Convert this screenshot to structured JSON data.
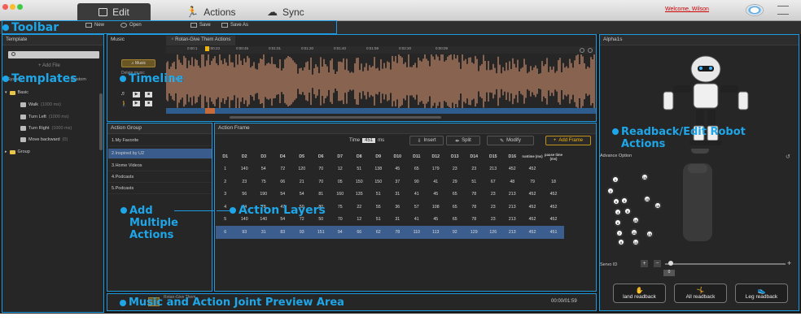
{
  "titlebar": {
    "tabs": [
      "Edit",
      "Actions",
      "Sync"
    ],
    "welcome": "Welcome, Wilson"
  },
  "toolbar": {
    "new": "New",
    "open": "Open",
    "save": "Save",
    "save_as": "Save As"
  },
  "callouts": {
    "toolbar": "Toolbar",
    "templates": "Templates",
    "timeline": "Timeline",
    "add_multiple": [
      "Add",
      "Multiple",
      "Actions"
    ],
    "action_layers": "Action Layers",
    "readback": [
      "Readback/Edit Robot",
      "Actions"
    ],
    "preview": "Music and Action Joint Preview Area"
  },
  "template": {
    "title": "Template",
    "search_placeholder": "",
    "add_file": "Add File",
    "system_label": "System",
    "custom_label": "Custom",
    "folder_basic": "Basic",
    "items": [
      {
        "name": "Walk",
        "time": "(1000 ms)"
      },
      {
        "name": "Turn Left",
        "time": "(1000 ms)"
      },
      {
        "name": "Turn Right",
        "time": "(1000 ms)"
      },
      {
        "name": "Move backward",
        "time": "(0)"
      }
    ],
    "folder_group": "Group"
  },
  "music": {
    "title": "Music",
    "track_tab": "Rotan-Give Them Actions",
    "ticks": [
      "0:00:1",
      "0:00:23",
      "0:00:45",
      "0:01:01",
      "0:01:20",
      "0:01:40",
      "0:01:59",
      "0:02:20",
      "0:00:09"
    ],
    "music_btn": "Music",
    "delete_btn": "Delete music"
  },
  "action_group": {
    "title": "Action Group",
    "items": [
      "1.My Favorite",
      "2.Inspired by U2",
      "3.Home Videos",
      "4.Podcasts",
      "5.Podcasts"
    ],
    "selected": 1
  },
  "action_frame": {
    "title": "Action Frame",
    "time_label": "Time",
    "time_value": "451",
    "time_unit": "ms",
    "insert": "Insert",
    "split": "Split",
    "modify": "Modify",
    "add_frame": "Add Frame",
    "headers": [
      "D1",
      "D2",
      "D3",
      "D4",
      "D5",
      "D6",
      "D7",
      "D8",
      "D9",
      "D10",
      "D11",
      "D12",
      "D13",
      "D14",
      "D15",
      "D16",
      "runtime (ms)",
      "pause time (ms)"
    ],
    "rows": [
      [
        "1",
        "140",
        "54",
        "72",
        "120",
        "70",
        "12",
        "51",
        "138",
        "45",
        "65",
        "179",
        "23",
        "23",
        "213",
        "452",
        "452"
      ],
      [
        "2",
        "23",
        "75",
        "06",
        "21",
        "70",
        "05",
        "150",
        "150",
        "37",
        "90",
        "41",
        "29",
        "51",
        "67",
        "48",
        "79",
        "18"
      ],
      [
        "3",
        "56",
        "190",
        "54",
        "54",
        "81",
        "160",
        "135",
        "51",
        "31",
        "41",
        "45",
        "65",
        "78",
        "23",
        "213",
        "452",
        "452"
      ],
      [
        "4",
        "44",
        "78",
        "47",
        "50",
        "80",
        "75",
        "22",
        "55",
        "36",
        "57",
        "108",
        "65",
        "78",
        "23",
        "213",
        "452",
        "452"
      ],
      [
        "5",
        "140",
        "140",
        "54",
        "72",
        "50",
        "70",
        "12",
        "51",
        "31",
        "41",
        "45",
        "65",
        "78",
        "23",
        "213",
        "452",
        "452"
      ],
      [
        "6",
        "93",
        "31",
        "83",
        "93",
        "151",
        "94",
        "66",
        "62",
        "78",
        "110",
        "113",
        "92",
        "129",
        "126",
        "213",
        "452",
        "451"
      ]
    ],
    "selected_row": 5
  },
  "robot_panel": {
    "title": "Alpha1s",
    "advance_option": "Advance Option",
    "servo_id_label": "Servo ID",
    "servo_value": "0",
    "joints": [
      "1",
      "14",
      "2",
      "3",
      "15",
      "4",
      "5",
      "16",
      "6",
      "10",
      "7",
      "11",
      "8",
      "12",
      "9",
      "13"
    ],
    "readback_buttons": [
      "land readback",
      "All readback",
      "Leg readback"
    ]
  },
  "preview": {
    "track": "Rotan-Give Them",
    "time": "00:00/01:59"
  },
  "colors": {
    "accent": "#1ea6e8",
    "waveform": "#e8a07a",
    "selected": "#3c5e8e",
    "add_frame": "#f5b400"
  }
}
